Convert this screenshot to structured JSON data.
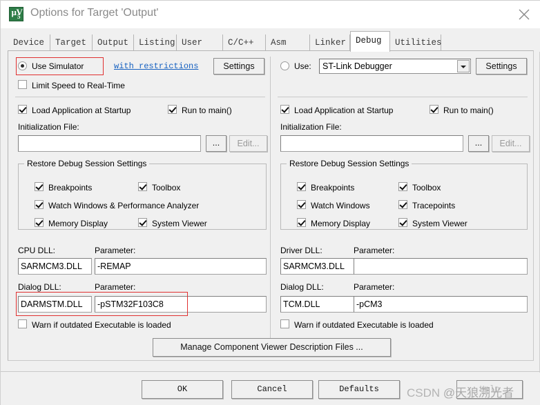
{
  "window": {
    "title": "Options for Target 'Output'",
    "icon": "uvision-logo-icon",
    "close_label": "✕"
  },
  "tabs": [
    {
      "label": "Device",
      "active": false
    },
    {
      "label": "Target",
      "active": false
    },
    {
      "label": "Output",
      "active": false
    },
    {
      "label": "Listing",
      "active": false
    },
    {
      "label": "User",
      "active": false
    },
    {
      "label": "C/C++",
      "active": false
    },
    {
      "label": "Asm",
      "active": false
    },
    {
      "label": "Linker",
      "active": false
    },
    {
      "label": "Debug",
      "active": true
    },
    {
      "label": "Utilities",
      "active": false
    }
  ],
  "left": {
    "use_simulator_label": "Use Simulator",
    "use_simulator_checked": true,
    "with_restrictions_link": "with restrictions",
    "settings_button": "Settings",
    "limit_speed_label": "Limit Speed to Real-Time",
    "limit_speed_checked": false,
    "load_app_label": "Load Application at Startup",
    "load_app_checked": true,
    "run_to_main_label": "Run to main()",
    "run_to_main_checked": true,
    "init_file_label": "Initialization File:",
    "init_file_value": "",
    "browse_button": "...",
    "edit_button": "Edit...",
    "restore_group_title": "Restore Debug Session Settings",
    "restore_items": [
      {
        "label": "Breakpoints",
        "checked": true
      },
      {
        "label": "Toolbox",
        "checked": true
      },
      {
        "label": "Watch Windows & Performance Analyzer",
        "checked": true
      },
      {
        "label": "Memory Display",
        "checked": true
      },
      {
        "label": "System Viewer",
        "checked": true
      }
    ],
    "cpu_dll_label": "CPU DLL:",
    "cpu_dll_value": "SARMCM3.DLL",
    "cpu_param_label": "Parameter:",
    "cpu_param_value": "-REMAP",
    "dialog_dll_label": "Dialog DLL:",
    "dialog_dll_value": "DARMSTM.DLL",
    "dialog_param_label": "Parameter:",
    "dialog_param_value": "-pSTM32F103C8",
    "warn_label": "Warn if outdated Executable is loaded",
    "warn_checked": false
  },
  "right": {
    "use_label": "Use:",
    "use_radio_checked": false,
    "debugger_selected": "ST-Link Debugger",
    "debugger_options": [
      "ST-Link Debugger"
    ],
    "settings_button": "Settings",
    "load_app_label": "Load Application at Startup",
    "load_app_checked": true,
    "run_to_main_label": "Run to main()",
    "run_to_main_checked": true,
    "init_file_label": "Initialization File:",
    "init_file_value": "",
    "browse_button": "...",
    "edit_button": "Edit...",
    "restore_group_title": "Restore Debug Session Settings",
    "restore_items": [
      {
        "label": "Breakpoints",
        "checked": true
      },
      {
        "label": "Toolbox",
        "checked": true
      },
      {
        "label": "Watch Windows",
        "checked": true
      },
      {
        "label": "Tracepoints",
        "checked": true
      },
      {
        "label": "Memory Display",
        "checked": true
      },
      {
        "label": "System Viewer",
        "checked": true
      }
    ],
    "driver_dll_label": "Driver DLL:",
    "driver_dll_value": "SARMCM3.DLL",
    "driver_param_label": "Parameter:",
    "driver_param_value": "",
    "dialog_dll_label": "Dialog DLL:",
    "dialog_dll_value": "TCM.DLL",
    "dialog_param_label": "Parameter:",
    "dialog_param_value": "-pCM3",
    "warn_label": "Warn if outdated Executable is loaded",
    "warn_checked": false
  },
  "manage_button": "Manage Component Viewer Description Files ...",
  "footer": {
    "ok": "OK",
    "cancel": "Cancel",
    "defaults": "Defaults",
    "help": "Help"
  },
  "watermark": {
    "prefix": "CSDN ",
    "handle": "@天狼溯光者"
  },
  "highlight_color": "#e03030"
}
